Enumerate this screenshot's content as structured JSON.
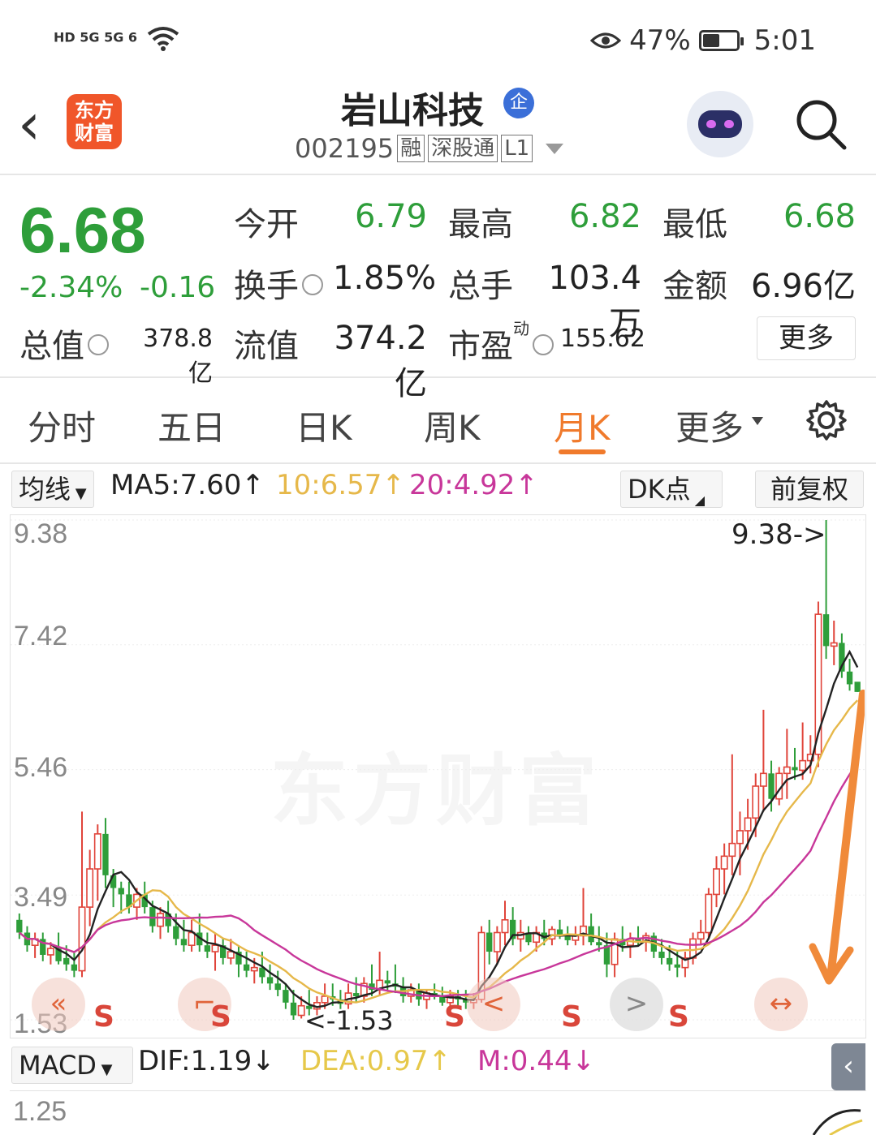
{
  "status_bar": {
    "left_icons": "HD 5G 5G 6",
    "battery_pct": "47%",
    "time": "5:01",
    "icons": [
      "eye-icon",
      "battery-icon",
      "wifi-icon",
      "signal-icon"
    ]
  },
  "header": {
    "app_logo": "东方财富",
    "stock_name": "岩山科技",
    "badge": "企",
    "code": "002195",
    "tags": [
      "融",
      "深股通",
      "L1"
    ]
  },
  "quote": {
    "price": "6.68",
    "change_pct": "-2.34%",
    "change": "-0.16",
    "fields": {
      "open_label": "今开",
      "open": "6.79",
      "high_label": "最高",
      "high": "6.82",
      "low_label": "最低",
      "low": "6.68",
      "turnover_label": "换手",
      "turnover": "1.85%",
      "volume_label": "总手",
      "volume": "103.4万",
      "amount_label": "金额",
      "amount": "6.96亿",
      "mktcap_label": "总值",
      "mktcap": "378.8亿",
      "float_label": "流值",
      "float": "374.2亿",
      "pe_label": "市盈",
      "pe_sup": "动",
      "pe": "155.62"
    },
    "more_label": "更多"
  },
  "tabs": {
    "items": [
      "分时",
      "五日",
      "日K",
      "周K",
      "月K",
      "更多"
    ],
    "active": "月K"
  },
  "indicator_bar": {
    "ma_button": "均线",
    "ma5": "MA5:7.60↑",
    "ma10": "10:6.57↑",
    "ma20": "20:4.92↑",
    "dk_button": "DK点",
    "adjust_button": "前复权",
    "colors": {
      "ma5": "#222222",
      "ma10": "#e6b84a",
      "ma20": "#c8379a"
    }
  },
  "chart_data": {
    "type": "candlestick",
    "y_ticks": [
      "9.38",
      "7.42",
      "5.46",
      "3.49",
      "1.53"
    ],
    "ylim": [
      1.53,
      9.38
    ],
    "max_label": "9.38->",
    "min_label": "<-1.53",
    "watermark": "东方财富",
    "candles": [
      [
        3.1,
        3.2,
        2.8,
        2.9
      ],
      [
        2.9,
        3.0,
        2.6,
        2.7
      ],
      [
        2.7,
        2.9,
        2.5,
        2.8
      ],
      [
        2.8,
        2.9,
        2.45,
        2.55
      ],
      [
        2.55,
        2.75,
        2.4,
        2.65
      ],
      [
        2.65,
        2.9,
        2.4,
        2.45
      ],
      [
        2.5,
        2.7,
        2.3,
        2.4
      ],
      [
        2.4,
        2.6,
        2.2,
        2.3
      ],
      [
        2.3,
        4.8,
        2.2,
        3.3
      ],
      [
        3.3,
        4.2,
        3.0,
        3.9
      ],
      [
        3.9,
        4.6,
        3.4,
        4.45
      ],
      [
        4.45,
        4.7,
        3.6,
        3.8
      ],
      [
        3.8,
        3.9,
        3.3,
        3.6
      ],
      [
        3.6,
        3.7,
        3.2,
        3.5
      ],
      [
        3.5,
        3.7,
        3.2,
        3.3
      ],
      [
        3.3,
        3.6,
        3.1,
        3.5
      ],
      [
        3.5,
        3.7,
        3.2,
        3.3
      ],
      [
        3.3,
        3.4,
        2.9,
        3.0
      ],
      [
        3.0,
        3.3,
        2.8,
        3.2
      ],
      [
        3.2,
        3.4,
        2.9,
        3.0
      ],
      [
        3.0,
        3.2,
        2.7,
        2.8
      ],
      [
        2.8,
        3.1,
        2.6,
        2.7
      ],
      [
        2.7,
        3.1,
        2.6,
        2.9
      ],
      [
        2.9,
        3.2,
        2.6,
        2.7
      ],
      [
        2.7,
        2.9,
        2.5,
        2.6
      ],
      [
        2.6,
        2.9,
        2.3,
        2.7
      ],
      [
        2.7,
        2.8,
        2.4,
        2.5
      ],
      [
        2.5,
        2.8,
        2.4,
        2.6
      ],
      [
        2.6,
        2.7,
        2.2,
        2.4
      ],
      [
        2.4,
        2.6,
        2.2,
        2.3
      ],
      [
        2.3,
        2.5,
        2.1,
        2.35
      ],
      [
        2.35,
        2.6,
        2.1,
        2.2
      ],
      [
        2.2,
        2.4,
        2.0,
        2.1
      ],
      [
        2.1,
        2.3,
        1.9,
        2.0
      ],
      [
        2.0,
        2.1,
        1.7,
        1.8
      ],
      [
        1.8,
        2.0,
        1.53,
        1.6
      ],
      [
        1.6,
        1.9,
        1.55,
        1.75
      ],
      [
        1.75,
        2.0,
        1.6,
        1.7
      ],
      [
        1.7,
        1.9,
        1.6,
        1.8
      ],
      [
        1.8,
        2.1,
        1.7,
        1.9
      ],
      [
        1.9,
        2.1,
        1.75,
        1.85
      ],
      [
        1.85,
        2.0,
        1.7,
        1.78
      ],
      [
        1.78,
        2.1,
        1.7,
        1.95
      ],
      [
        1.95,
        2.2,
        1.8,
        1.9
      ],
      [
        1.9,
        2.2,
        1.8,
        2.1
      ],
      [
        2.1,
        2.4,
        1.9,
        2.0
      ],
      [
        2.0,
        2.6,
        1.9,
        2.15
      ],
      [
        2.15,
        2.3,
        2.0,
        2.1
      ],
      [
        2.1,
        2.4,
        1.95,
        2.05
      ],
      [
        2.05,
        2.2,
        1.8,
        1.9
      ],
      [
        1.9,
        2.1,
        1.8,
        2.0
      ],
      [
        2.0,
        2.1,
        1.75,
        1.85
      ],
      [
        1.85,
        2.0,
        1.7,
        1.95
      ],
      [
        1.95,
        2.1,
        1.85,
        1.9
      ],
      [
        1.9,
        2.05,
        1.75,
        1.8
      ],
      [
        1.8,
        2.0,
        1.7,
        1.9
      ],
      [
        1.9,
        2.0,
        1.75,
        1.85
      ],
      [
        1.85,
        2.0,
        1.7,
        1.8
      ],
      [
        1.8,
        1.95,
        1.7,
        1.85
      ],
      [
        1.85,
        3.0,
        1.8,
        2.9
      ],
      [
        2.9,
        3.1,
        2.4,
        2.6
      ],
      [
        2.6,
        3.0,
        2.4,
        2.9
      ],
      [
        2.9,
        3.4,
        2.7,
        3.1
      ],
      [
        3.1,
        3.3,
        2.7,
        2.8
      ],
      [
        2.8,
        3.1,
        2.6,
        2.9
      ],
      [
        2.9,
        3.0,
        2.7,
        2.75
      ],
      [
        2.75,
        3.0,
        2.6,
        2.9
      ],
      [
        2.9,
        3.1,
        2.7,
        2.8
      ],
      [
        2.8,
        3.0,
        2.7,
        2.95
      ],
      [
        2.95,
        3.1,
        2.8,
        2.85
      ],
      [
        2.85,
        3.0,
        2.7,
        2.78
      ],
      [
        2.78,
        3.0,
        2.7,
        2.85
      ],
      [
        2.85,
        3.6,
        2.7,
        3.0
      ],
      [
        3.0,
        3.2,
        2.7,
        2.75
      ],
      [
        2.75,
        3.0,
        2.6,
        2.7
      ],
      [
        2.7,
        2.9,
        2.2,
        2.4
      ],
      [
        2.4,
        2.9,
        2.2,
        2.8
      ],
      [
        2.8,
        3.0,
        2.6,
        2.7
      ],
      [
        2.7,
        2.9,
        2.5,
        2.8
      ],
      [
        2.8,
        3.0,
        2.7,
        2.75
      ],
      [
        2.75,
        2.9,
        2.6,
        2.85
      ],
      [
        2.85,
        2.9,
        2.5,
        2.6
      ],
      [
        2.6,
        2.8,
        2.4,
        2.5
      ],
      [
        2.5,
        2.7,
        2.3,
        2.4
      ],
      [
        2.4,
        2.6,
        2.2,
        2.35
      ],
      [
        2.35,
        2.6,
        2.2,
        2.5
      ],
      [
        2.5,
        2.9,
        2.4,
        2.8
      ],
      [
        2.8,
        3.1,
        2.7,
        2.9
      ],
      [
        2.9,
        3.6,
        2.8,
        3.5
      ],
      [
        3.5,
        4.1,
        3.3,
        3.9
      ],
      [
        3.9,
        4.3,
        3.5,
        4.1
      ],
      [
        4.1,
        5.7,
        3.8,
        4.3
      ],
      [
        4.3,
        4.8,
        3.8,
        4.5
      ],
      [
        4.5,
        5.0,
        4.2,
        4.7
      ],
      [
        4.7,
        5.4,
        4.4,
        5.2
      ],
      [
        5.2,
        6.4,
        4.8,
        5.4
      ],
      [
        5.4,
        5.6,
        4.8,
        5.0
      ],
      [
        5.0,
        5.5,
        4.9,
        5.4
      ],
      [
        5.4,
        6.1,
        5.0,
        5.5
      ],
      [
        5.5,
        5.8,
        5.3,
        5.45
      ],
      [
        5.45,
        6.2,
        5.3,
        5.6
      ],
      [
        5.6,
        6.0,
        5.4,
        5.7
      ],
      [
        5.7,
        8.1,
        5.5,
        7.9
      ],
      [
        7.9,
        9.38,
        7.2,
        7.4
      ],
      [
        7.4,
        7.8,
        7.1,
        7.45
      ],
      [
        7.45,
        7.6,
        6.9,
        7.0
      ],
      [
        7.0,
        7.2,
        6.7,
        6.8
      ],
      [
        6.84,
        6.82,
        6.68,
        6.68
      ]
    ],
    "series": [
      {
        "name": "MA5",
        "color": "#222222"
      },
      {
        "name": "10",
        "color": "#e6b84a"
      },
      {
        "name": "20",
        "color": "#c8379a"
      }
    ]
  },
  "signal_marks": [
    "S",
    "S",
    "S",
    "S",
    "S"
  ],
  "float_buttons": [
    "«",
    "⌐",
    "<",
    ">",
    "↔"
  ],
  "macd": {
    "button": "MACD",
    "dif": "DIF:1.19↓",
    "dea": "DEA:0.97↑",
    "m": "M:0.44↓",
    "y_tick": "1.25",
    "colors": {
      "dif": "#222222",
      "dea": "#e6c84a",
      "m": "#c8379a"
    }
  }
}
